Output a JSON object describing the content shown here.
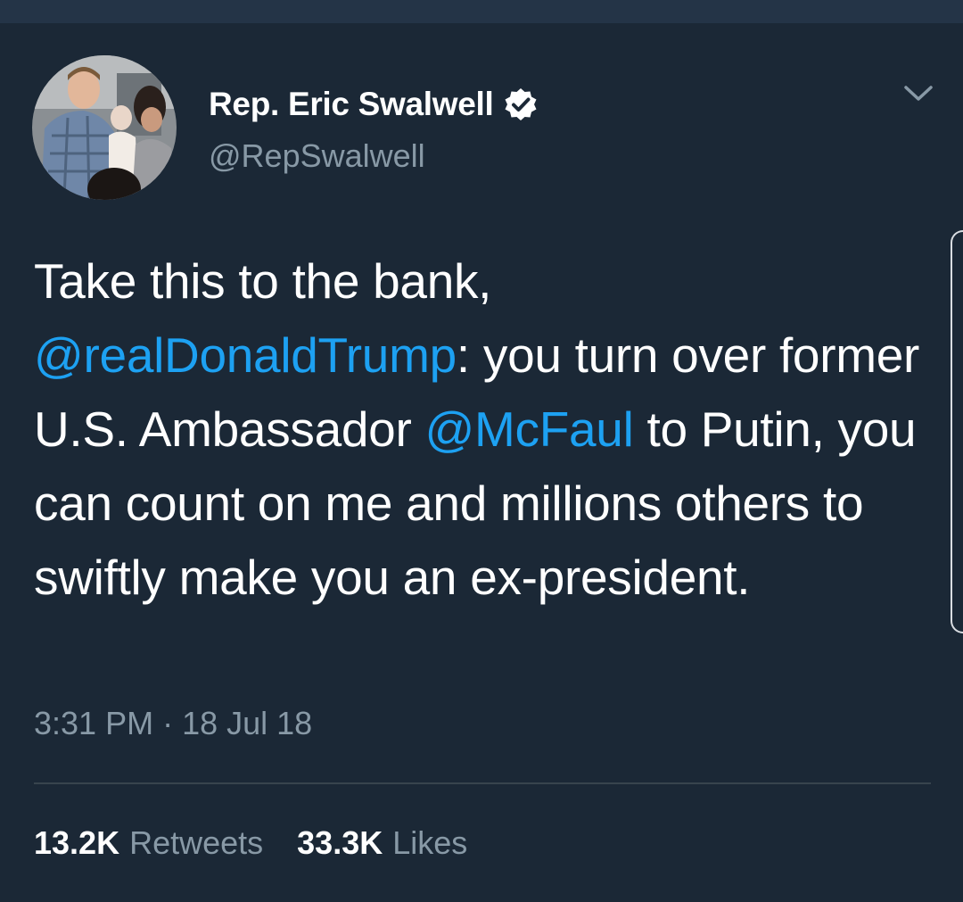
{
  "tweet": {
    "display_name": "Rep. Eric Swalwell",
    "handle": "@RepSwalwell",
    "verified_icon": "verified-badge-icon",
    "menu_icon": "chevron-down-icon",
    "text": {
      "part1": "Take this to the bank, ",
      "mention1": "@realDonaldTrump",
      "part2": ": you turn over former U.S. Ambassador ",
      "mention2": "@McFaul",
      "part3": " to Putin, you can count on me and millions others to swiftly make you an ex-president."
    },
    "time": "3:31 PM",
    "separator": "·",
    "date": "18 Jul 18",
    "retweets_count": "13.2K",
    "retweets_label": "Retweets",
    "likes_count": "33.3K",
    "likes_label": "Likes"
  },
  "colors": {
    "background": "#1b2836",
    "text": "#ffffff",
    "muted": "#8899a6",
    "link": "#1da1f2",
    "divider": "#38444d"
  }
}
